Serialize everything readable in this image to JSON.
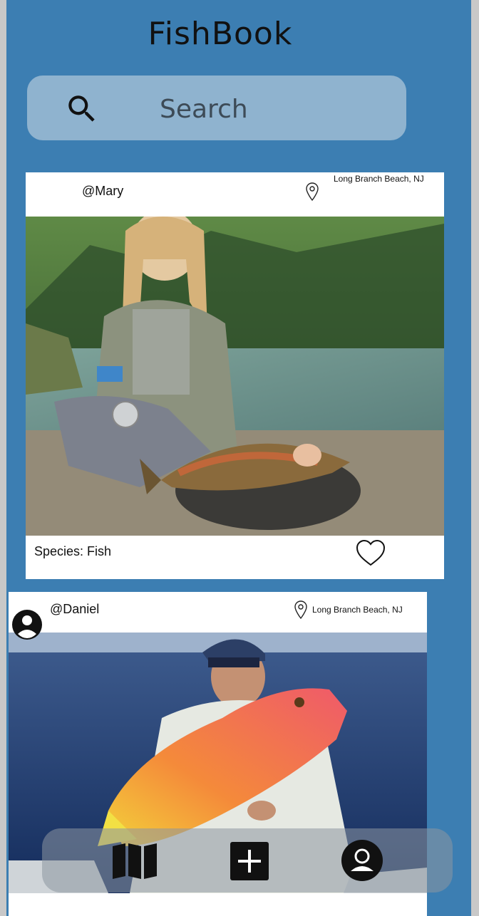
{
  "app": {
    "title": "FishBook"
  },
  "search": {
    "placeholder": "Search"
  },
  "posts": [
    {
      "username": "@Mary",
      "location": "Long Branch Beach, NJ",
      "species": "Species: Fish"
    },
    {
      "username": "@Daniel",
      "location": "Long Branch Beach, NJ"
    }
  ],
  "icons": {
    "search": "search-icon",
    "location": "map-pin-icon",
    "like": "heart-icon",
    "avatar": "account-circle-icon",
    "map": "map-icon",
    "add": "add-box-icon",
    "profile": "profile-circle-icon"
  },
  "colors": {
    "background": "#3c7eb2",
    "search_bar": "#8fb3cf",
    "card": "#ffffff"
  }
}
